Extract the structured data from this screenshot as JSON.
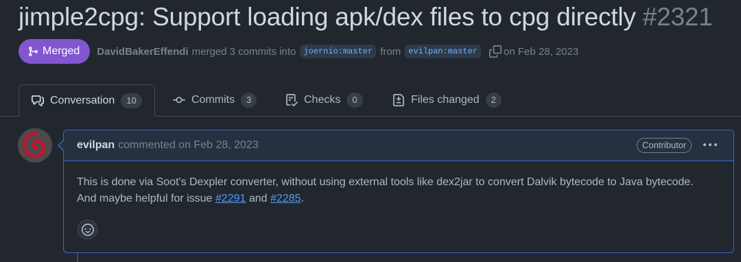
{
  "pr": {
    "title": "jimple2cpg: Support loading apk/dex files to cpg directly",
    "number": "#2321",
    "state": "Merged",
    "merged_by": "DavidBakerEffendi",
    "merge_text": "merged 3 commits into",
    "base_branch": "joernio:master",
    "from_text": "from",
    "head_branch": "evilpan:master",
    "date_text": "on Feb 28, 2023"
  },
  "tabs": [
    {
      "label": "Conversation",
      "count": "10",
      "icon": "comment-discussion-icon"
    },
    {
      "label": "Commits",
      "count": "3",
      "icon": "git-commit-icon"
    },
    {
      "label": "Checks",
      "count": "0",
      "icon": "checklist-icon"
    },
    {
      "label": "Files changed",
      "count": "2",
      "icon": "file-diff-icon"
    }
  ],
  "comment": {
    "author": "evilpan",
    "action": "commented on Feb 28, 2023",
    "role": "Contributor",
    "body_line1": "This is done via Soot's Dexpler converter, without using external tools like dex2jar to convert Dalvik bytecode to Java bytecode.",
    "body_line2_prefix": "And maybe helpful for issue",
    "issue_link_1": "#2291",
    "conj": "and",
    "issue_link_2": "#2285",
    "suffix": "."
  },
  "colors": {
    "background": "#22272e",
    "merged": "#8256d0",
    "link": "#539bf5",
    "comment_border": "#316dca"
  }
}
